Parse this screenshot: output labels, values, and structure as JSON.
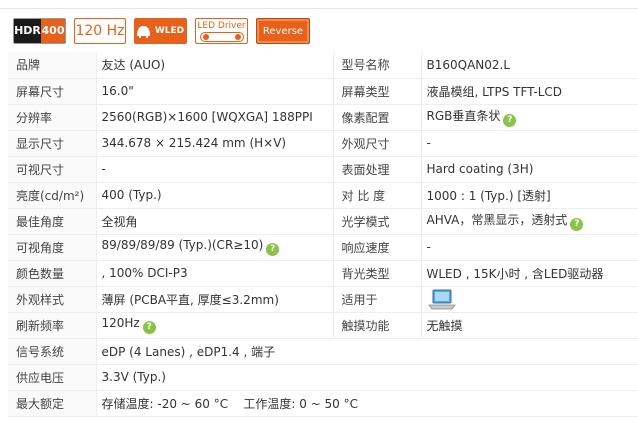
{
  "badges": {
    "hdr_left": "HDR",
    "hdr_right": "400",
    "refresh": "120 Hz",
    "wled": "WLED",
    "led_driver": "LED Driver",
    "reverse": "Reverse"
  },
  "help_glyph": "?",
  "rows": [
    {
      "l1": "品牌",
      "v1": "友达 (AUO)",
      "l2": "型号名称",
      "v2": "B160QAN02.L"
    },
    {
      "l1": "屏幕尺寸",
      "v1": "16.0\"",
      "l2": "屏幕类型",
      "v2": "液晶模组,   LTPS TFT-LCD"
    },
    {
      "l1": "分辨率",
      "v1": "2560(RGB)×1600   [WQXGA]   188PPI",
      "l2": "像素配置",
      "v2": "RGB垂直条状"
    },
    {
      "l1": "显示尺寸",
      "v1": "344.678 × 215.424 mm (H×V)",
      "l2": "外观尺寸",
      "v2": "-"
    },
    {
      "l1": "可视尺寸",
      "v1": "-",
      "l2": "表面处理",
      "v2": "Hard coating (3H)"
    },
    {
      "l1": "亮度(cd/m²)",
      "v1": "400 (Typ.)",
      "l2": "对 比 度",
      "v2": "1000 : 1 (Typ.) [透射]"
    },
    {
      "l1": "最佳角度",
      "v1": "全视角",
      "l2": "光学模式",
      "v2": "AHVA，常黑显示，透射式"
    },
    {
      "l1": "可视角度",
      "v1": "89/89/89/89 (Typ.)(CR≥10)",
      "l2": "响应速度",
      "v2": "-"
    },
    {
      "l1": "颜色数量",
      "v1": ", 100% DCI-P3",
      "l2": "背光类型",
      "v2": "WLED , 15K小时 , 含LED驱动器"
    },
    {
      "l1": "外观样式",
      "v1": "薄屏 (PCBA平直, 厚度≤3.2mm)",
      "l2": "适用于",
      "v2": ""
    },
    {
      "l1": "刷新频率",
      "v1": "120Hz",
      "l2": "触摸功能",
      "v2": "无触摸"
    },
    {
      "l1": "信号系统",
      "v1": "eDP (4 Lanes) , eDP1.4 , 端子"
    },
    {
      "l1": "供应电压",
      "v1": "3.3V (Typ.)"
    },
    {
      "l1": "最大额定",
      "v1": "存储温度: -20 ~ 60 °C    工作温度: 0 ~ 50 °C"
    }
  ],
  "colors": {
    "accent": "#e8611a",
    "help": "#8bc34a"
  },
  "icons": {
    "laptop": "laptop-icon",
    "help": "help-icon",
    "bulb": "bulb-icon"
  }
}
